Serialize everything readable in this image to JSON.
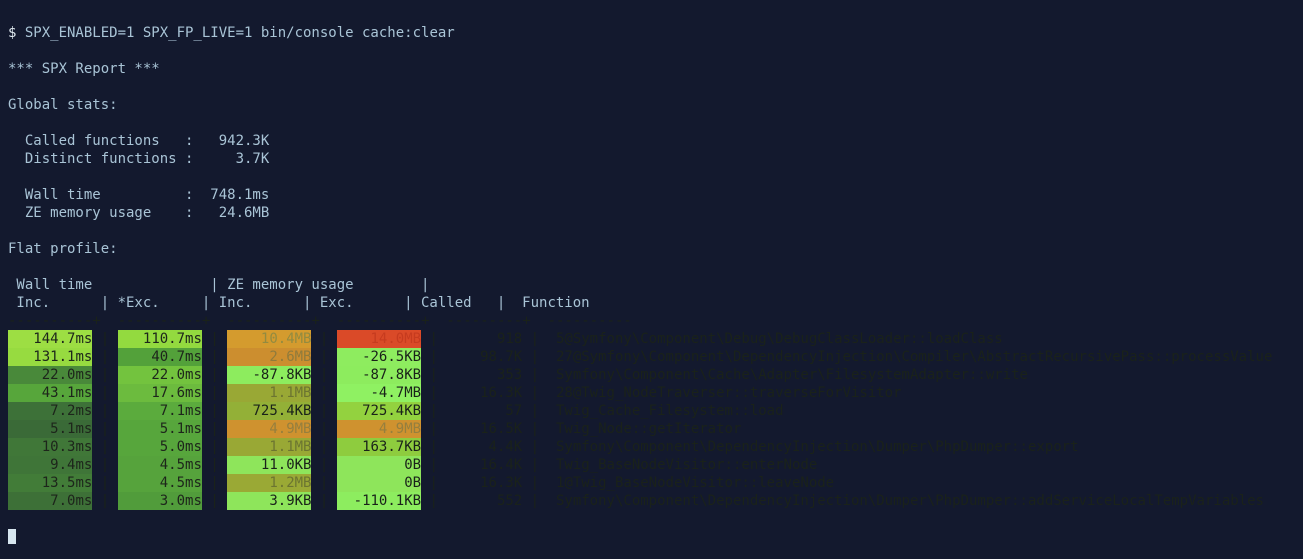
{
  "command": "SPX_ENABLED=1 SPX_FP_LIVE=1 bin/console cache:clear",
  "report_title": "*** SPX Report ***",
  "global_stats_label": "Global stats:",
  "global_stats": [
    {
      "label": "Called functions",
      "value": "942.3K"
    },
    {
      "label": "Distinct functions",
      "value": "3.7K"
    }
  ],
  "global_stats2": [
    {
      "label": "Wall time",
      "value": "748.1ms"
    },
    {
      "label": "ZE memory usage",
      "value": "24.6MB"
    }
  ],
  "flat_profile_label": "Flat profile:",
  "header_group_wall": "Wall time",
  "header_group_ze": "ZE memory usage",
  "header_inc": "Inc.",
  "header_exc_star": "*Exc.",
  "header_exc": "Exc.",
  "header_called": "Called",
  "header_function": "Function",
  "chart_data": {
    "type": "table",
    "columns": [
      "wall_inc",
      "wall_exc",
      "ze_inc",
      "ze_exc",
      "called",
      "function"
    ],
    "rows": [
      {
        "wall_inc": "144.7ms",
        "wall_exc": "110.7ms",
        "ze_inc": "10.4MB",
        "ze_exc": "14.0MB",
        "called": "918",
        "function": "5@Symfony\\Component\\Debug\\DebugClassLoader::loadClass",
        "c_wall_inc": "#9dde43",
        "c_wall_exc": "#93da3f",
        "c_ze_inc": "#d49b2e",
        "c_ze_exc": "#da4a28",
        "c_ze_inc_fg": "#928b40",
        "c_ze_exc_fg": "#c63b1f"
      },
      {
        "wall_inc": "131.1ms",
        "wall_exc": "40.7ms",
        "ze_inc": "2.6MB",
        "ze_exc": "-26.5KB",
        "called": "98.7K",
        "function": "27@Symfony\\Component\\DependencyInjection\\Compiler\\AbstractRecursivePass::processValue",
        "c_wall_inc": "#97db40",
        "c_wall_exc": "#53a13a",
        "c_ze_inc": "#cc8e2f",
        "c_ze_exc": "#8eec5f",
        "c_ze_inc_fg": "#8f7b3c",
        "c_ze_exc_fg": "#1a221a"
      },
      {
        "wall_inc": "22.0ms",
        "wall_exc": "22.0ms",
        "ze_inc": "-87.8KB",
        "ze_exc": "-87.8KB",
        "called": "353",
        "function": "Symfony\\Component\\Cache\\Adapter\\FilesystemAdapter::write",
        "c_wall_inc": "#49893a",
        "c_wall_exc": "#73c33e",
        "c_ze_inc": "#8dec5e",
        "c_ze_exc": "#8dec5e",
        "c_ze_inc_fg": "#1a221a",
        "c_ze_exc_fg": "#1a221a"
      },
      {
        "wall_inc": "43.1ms",
        "wall_exc": "17.6ms",
        "ze_inc": "1.1MB",
        "ze_exc": "-4.7MB",
        "called": "16.3K",
        "function": "28@Twig_NodeTraverser::traverseForVisitor",
        "c_wall_inc": "#57a63b",
        "c_wall_exc": "#6cbb3e",
        "c_ze_inc": "#99a835",
        "c_ze_exc": "#8ff162",
        "c_ze_inc_fg": "#6c7531",
        "c_ze_exc_fg": "#1a221a"
      },
      {
        "wall_inc": "7.2ms",
        "wall_exc": "7.1ms",
        "ze_inc": "725.4KB",
        "ze_exc": "725.4KB",
        "called": "57",
        "function": "Twig_Cache_Filesystem::load",
        "c_wall_inc": "#3d7138",
        "c_wall_exc": "#5bab3d",
        "c_ze_inc": "#93b037",
        "c_ze_exc": "#93d23f",
        "c_ze_inc_fg": "#1a221a",
        "c_ze_exc_fg": "#1a221a"
      },
      {
        "wall_inc": "5.1ms",
        "wall_exc": "5.1ms",
        "ze_inc": "4.9MB",
        "ze_exc": "4.9MB",
        "called": "16.5K",
        "function": "Twig_Node::getIterator",
        "c_wall_inc": "#3a6a37",
        "c_wall_exc": "#57a63c",
        "c_ze_inc": "#cf922f",
        "c_ze_exc": "#cf922f",
        "c_ze_inc_fg": "#957f3e",
        "c_ze_exc_fg": "#957f3e"
      },
      {
        "wall_inc": "10.3ms",
        "wall_exc": "5.0ms",
        "ze_inc": "1.1MB",
        "ze_exc": "163.7KB",
        "called": "4.4K",
        "function": "Symfony\\Component\\DependencyInjection\\Dumper\\PhpDumper::export",
        "c_wall_inc": "#407738",
        "c_wall_exc": "#57a63c",
        "c_ze_inc": "#99a835",
        "c_ze_exc": "#8ecc3e",
        "c_ze_inc_fg": "#6c7531",
        "c_ze_exc_fg": "#1a221a"
      },
      {
        "wall_inc": "9.4ms",
        "wall_exc": "4.5ms",
        "ze_inc": "11.0KB",
        "ze_exc": "0B",
        "called": "16.4K",
        "function": "Twig_BaseNodeVisitor::enterNode",
        "c_wall_inc": "#3f7538",
        "c_wall_exc": "#56a33c",
        "c_ze_inc": "#8ee55b",
        "c_ze_exc": "#8ee55b",
        "c_ze_inc_fg": "#1a221a",
        "c_ze_exc_fg": "#1a221a"
      },
      {
        "wall_inc": "13.5ms",
        "wall_exc": "4.5ms",
        "ze_inc": "1.2MB",
        "ze_exc": "0B",
        "called": "16.3K",
        "function": "1@Twig_BaseNodeVisitor::leaveNode",
        "c_wall_inc": "#427c38",
        "c_wall_exc": "#56a33c",
        "c_ze_inc": "#9aa935",
        "c_ze_exc": "#8ee55b",
        "c_ze_inc_fg": "#6c7531",
        "c_ze_exc_fg": "#1a221a"
      },
      {
        "wall_inc": "7.0ms",
        "wall_exc": "3.0ms",
        "ze_inc": "3.9KB",
        "ze_exc": "-110.1KB",
        "called": "552",
        "function": "Symfony\\Component\\DependencyInjection\\Dumper\\PhpDumper::addServiceLocalTempVariables",
        "c_wall_inc": "#3d7037",
        "c_wall_exc": "#519c3b",
        "c_ze_inc": "#8ee55b",
        "c_ze_exc": "#8ded5f",
        "c_ze_inc_fg": "#1a221a",
        "c_ze_exc_fg": "#1a221a"
      }
    ]
  }
}
